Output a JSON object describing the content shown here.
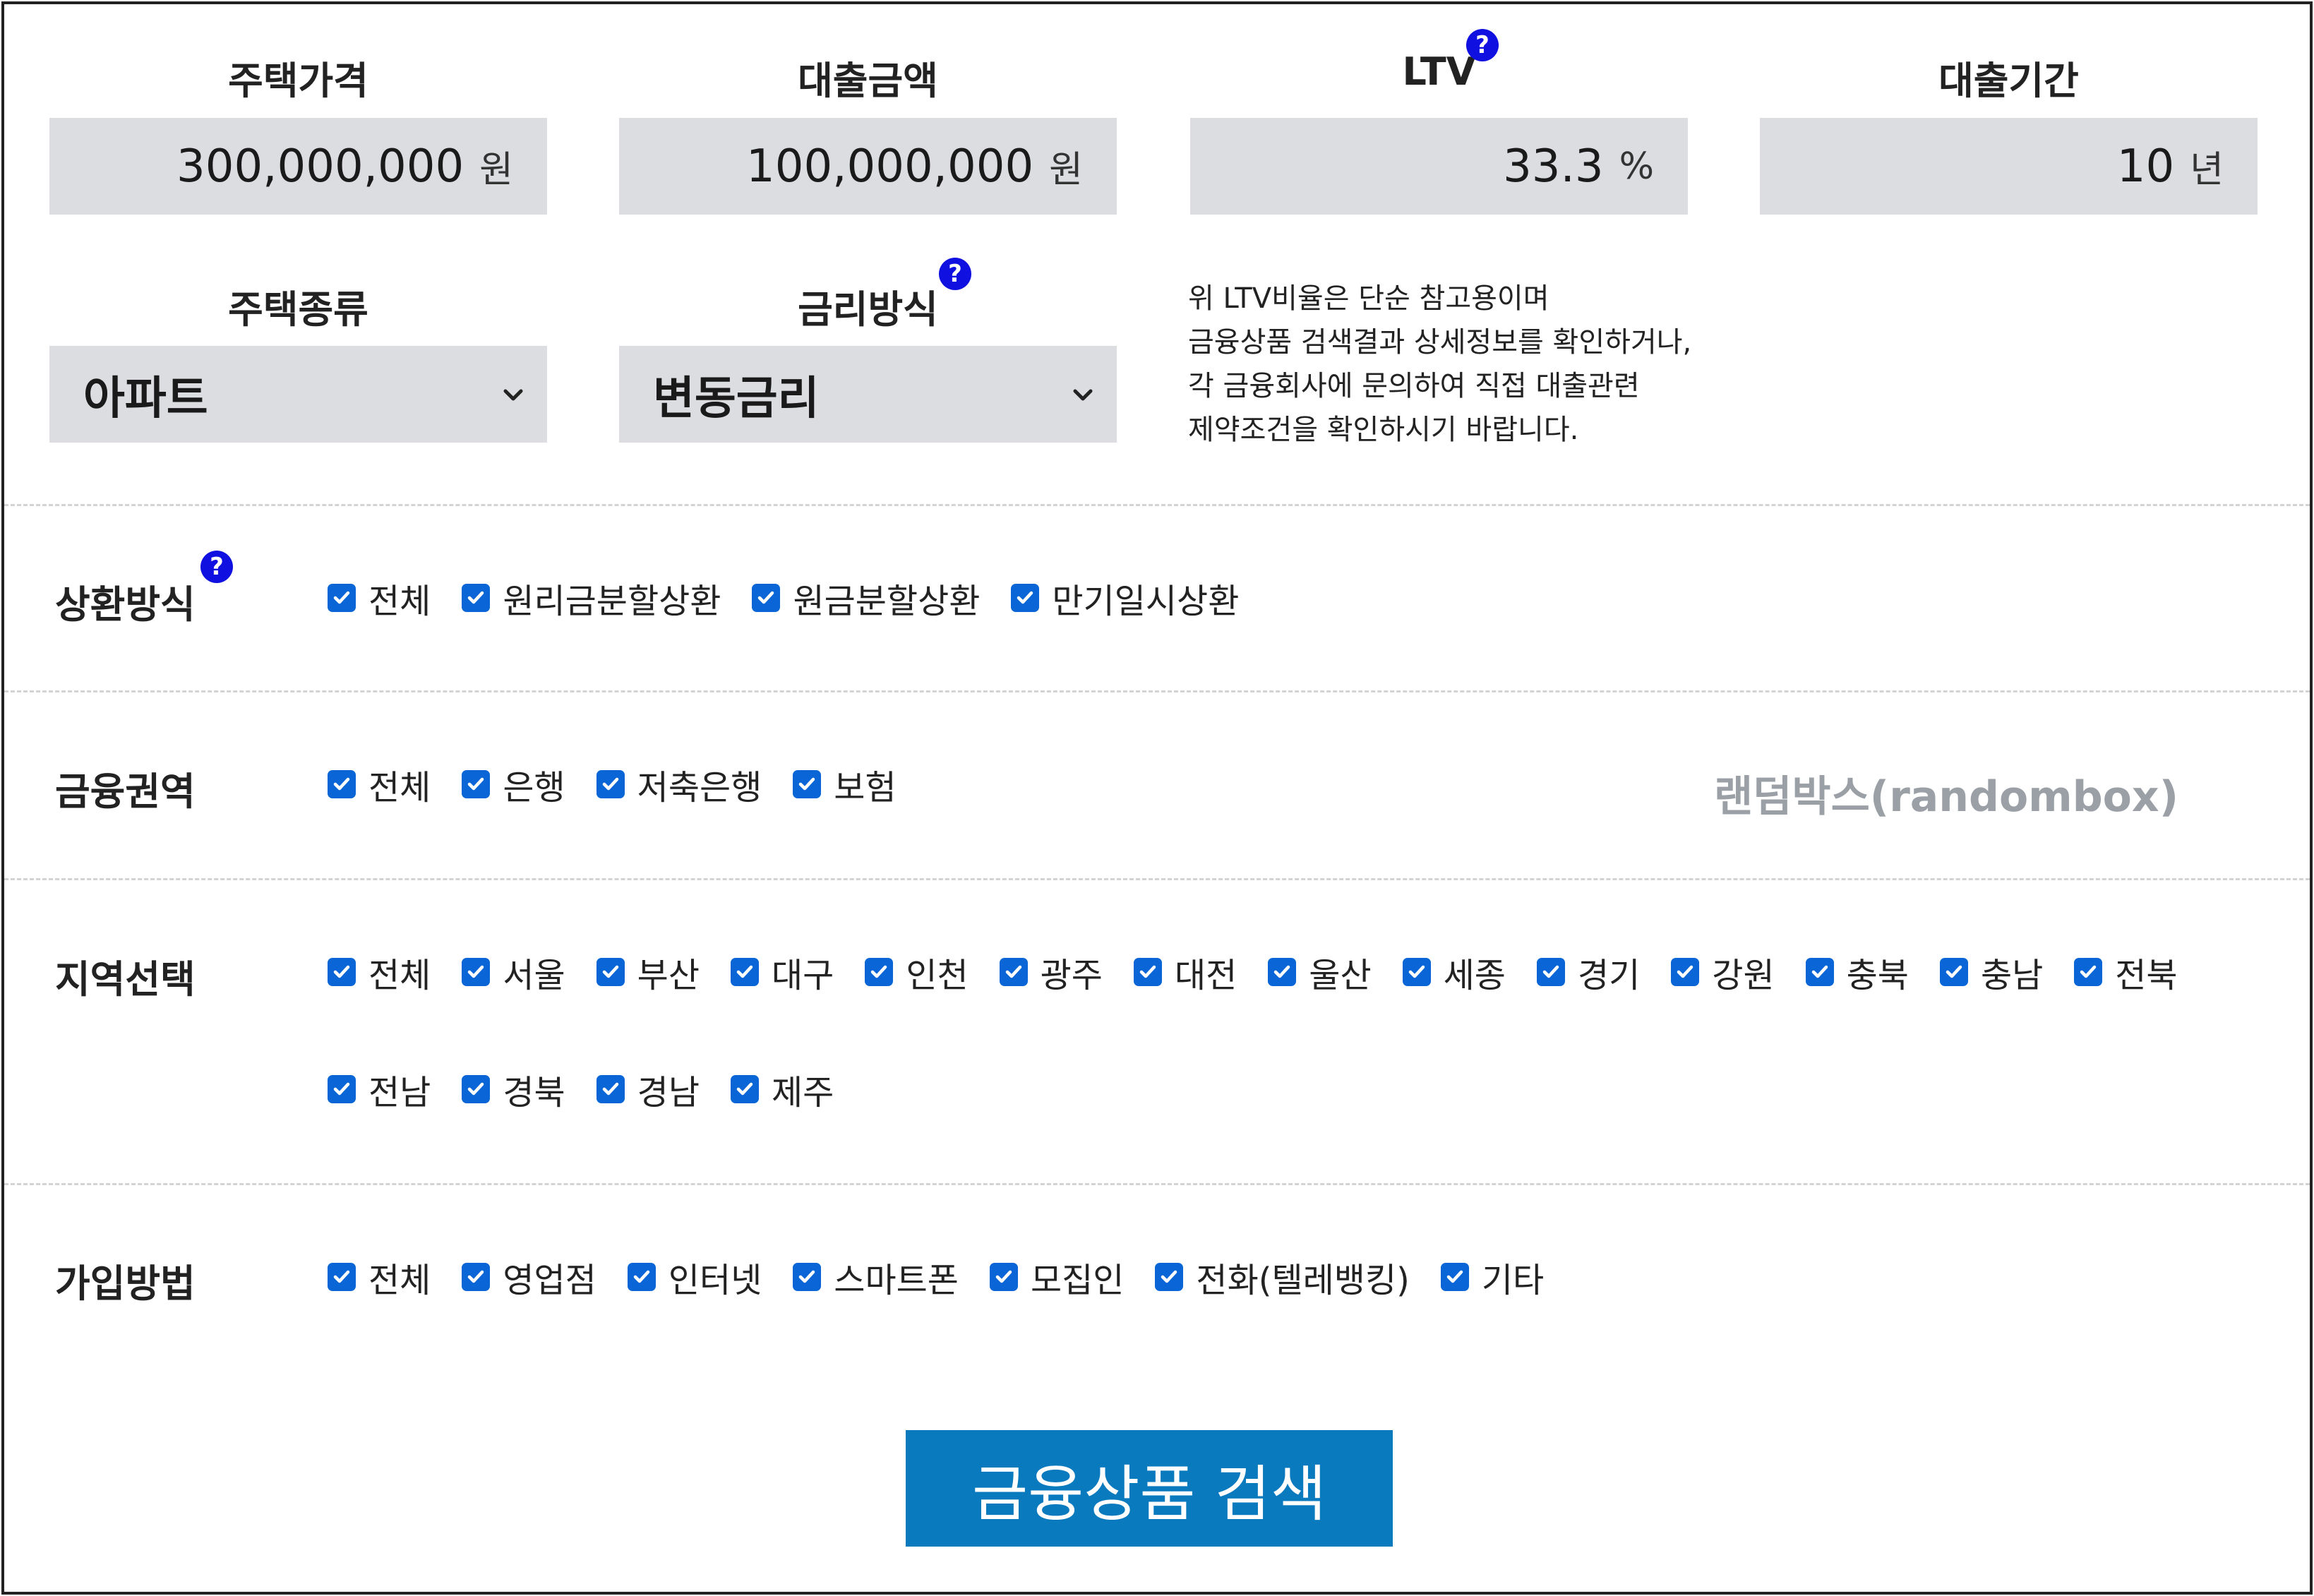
{
  "fields": {
    "house_price": {
      "label": "주택가격",
      "value": "300,000,000",
      "unit": "원"
    },
    "loan_amount": {
      "label": "대출금액",
      "value": "100,000,000",
      "unit": "원"
    },
    "ltv": {
      "label": "LTV",
      "value": "33.3",
      "unit": "%"
    },
    "loan_period": {
      "label": "대출기간",
      "value": "10",
      "unit": "년"
    },
    "house_type": {
      "label": "주택종류",
      "selected": "아파트"
    },
    "rate_type": {
      "label": "금리방식",
      "selected": "변동금리"
    }
  },
  "help_glyph": "?",
  "ltv_note": [
    "위 LTV비율은 단순 참고용이며",
    "금융상품 검색결과 상세정보를 확인하거나,",
    "각 금융회사에 문의하여 직접 대출관련",
    "제약조건을 확인하시기 바랍니다."
  ],
  "repayment": {
    "label": "상환방식",
    "options": [
      "전체",
      "원리금분할상환",
      "원금분할상환",
      "만기일시상환"
    ]
  },
  "sector": {
    "label": "금융권역",
    "options": [
      "전체",
      "은행",
      "저축은행",
      "보험"
    ]
  },
  "region": {
    "label": "지역선택",
    "row1": [
      "전체",
      "서울",
      "부산",
      "대구",
      "인천",
      "광주",
      "대전",
      "울산",
      "세종",
      "경기",
      "강원",
      "충북",
      "충남",
      "전북"
    ],
    "row2": [
      "전남",
      "경북",
      "경남",
      "제주"
    ]
  },
  "join_method": {
    "label": "가입방법",
    "options": [
      "전체",
      "영업점",
      "인터넷",
      "스마트폰",
      "모집인",
      "전화(텔레뱅킹)",
      "기타"
    ]
  },
  "watermark": "랜덤박스(randombox)",
  "search_button": "금융상품 검색",
  "colors": {
    "checkbox": "#0a66d6",
    "button": "#0a7abf",
    "help": "#1010e0",
    "input_bg": "#dcdde1"
  }
}
